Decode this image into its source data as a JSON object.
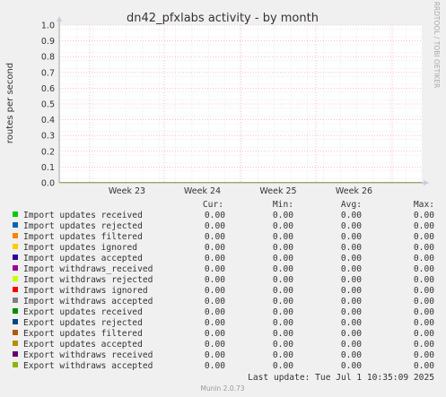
{
  "colors": {
    "background": "#f0f0f0",
    "plot": "#ffffff",
    "grid": "#ff9999",
    "axis": "#cccccc",
    "text": "#333333"
  },
  "side_label": "RRDTOOL / TOBI OETIKER",
  "legend_headers": {
    "cur": "Cur:",
    "min": "Min:",
    "avg": "Avg:",
    "max": "Max:"
  },
  "last_update": "Last update: Tue Jul  1 10:35:09 2025",
  "munin_version": "Munin 2.0.73",
  "chart_data": {
    "type": "line",
    "title": "dn42_pfxlabs activity - by month",
    "ylabel": "routes per second",
    "ylim": [
      0,
      1
    ],
    "yticks": [
      "0.0",
      "0.1",
      "0.2",
      "0.3",
      "0.4",
      "0.5",
      "0.6",
      "0.7",
      "0.8",
      "0.9",
      "1.0"
    ],
    "xticks": [
      "Week 23",
      "Week 24",
      "Week 25",
      "Week 26"
    ],
    "grid": true,
    "series": [
      {
        "name": "Import updates received",
        "color": "#00cc00",
        "cur": "0.00",
        "min": "0.00",
        "avg": "0.00",
        "max": "0.00"
      },
      {
        "name": "Import updates rejected",
        "color": "#0066b3",
        "cur": "0.00",
        "min": "0.00",
        "avg": "0.00",
        "max": "0.00"
      },
      {
        "name": "Import updates filtered",
        "color": "#ff8000",
        "cur": "0.00",
        "min": "0.00",
        "avg": "0.00",
        "max": "0.00"
      },
      {
        "name": "Import updates ignored",
        "color": "#ffcc00",
        "cur": "0.00",
        "min": "0.00",
        "avg": "0.00",
        "max": "0.00"
      },
      {
        "name": "Import updates accepted",
        "color": "#330099",
        "cur": "0.00",
        "min": "0.00",
        "avg": "0.00",
        "max": "0.00"
      },
      {
        "name": "Import withdraws_received",
        "color": "#990099",
        "cur": "0.00",
        "min": "0.00",
        "avg": "0.00",
        "max": "0.00"
      },
      {
        "name": "Import withdraws rejected",
        "color": "#ccff00",
        "cur": "0.00",
        "min": "0.00",
        "avg": "0.00",
        "max": "0.00"
      },
      {
        "name": "Import withdraws ignored",
        "color": "#ff0000",
        "cur": "0.00",
        "min": "0.00",
        "avg": "0.00",
        "max": "0.00"
      },
      {
        "name": "Import withdraws accepted",
        "color": "#808080",
        "cur": "0.00",
        "min": "0.00",
        "avg": "0.00",
        "max": "0.00"
      },
      {
        "name": "Export updates received",
        "color": "#008f00",
        "cur": "0.00",
        "min": "0.00",
        "avg": "0.00",
        "max": "0.00"
      },
      {
        "name": "Export updates rejected",
        "color": "#00487d",
        "cur": "0.00",
        "min": "0.00",
        "avg": "0.00",
        "max": "0.00"
      },
      {
        "name": "Export updates filtered",
        "color": "#b35a00",
        "cur": "0.00",
        "min": "0.00",
        "avg": "0.00",
        "max": "0.00"
      },
      {
        "name": "Export updates accepted",
        "color": "#b38f00",
        "cur": "0.00",
        "min": "0.00",
        "avg": "0.00",
        "max": "0.00"
      },
      {
        "name": "Export withdraws received",
        "color": "#6b006b",
        "cur": "0.00",
        "min": "0.00",
        "avg": "0.00",
        "max": "0.00"
      },
      {
        "name": "Export withdraws accepted",
        "color": "#8fb300",
        "cur": "0.00",
        "min": "0.00",
        "avg": "0.00",
        "max": "0.00"
      }
    ]
  }
}
